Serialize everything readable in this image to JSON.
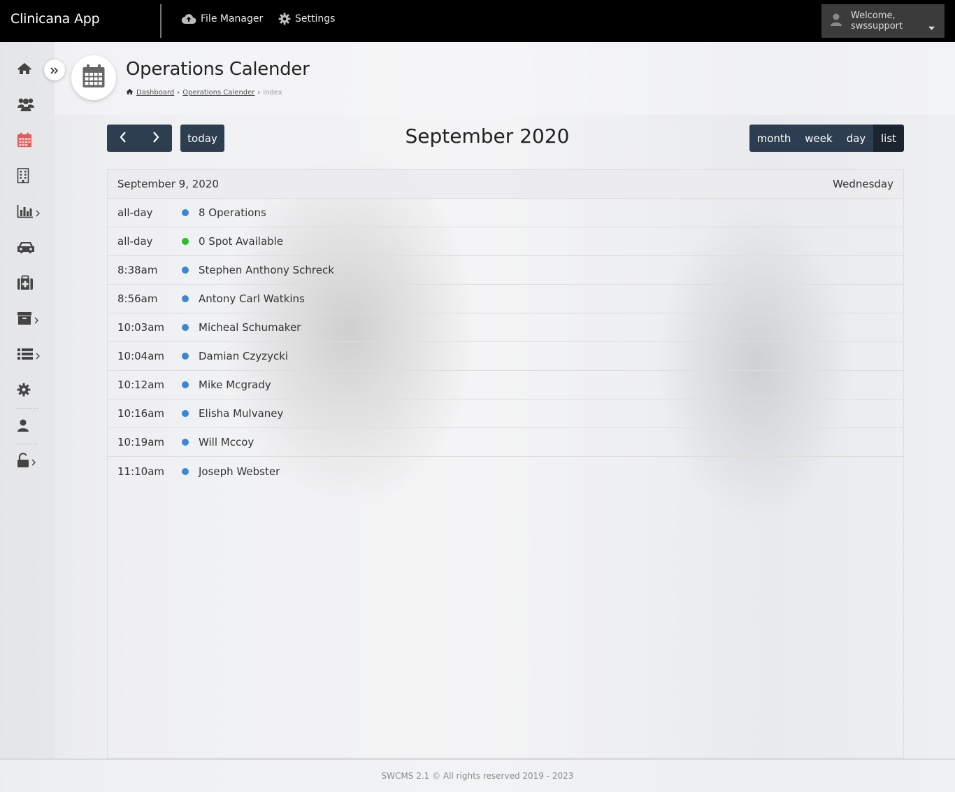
{
  "app": {
    "brand": "Clinicana App"
  },
  "topnav": {
    "file_manager": "File Manager",
    "settings": "Settings",
    "welcome_line1": "Welcome,",
    "welcome_line2": "swssupport"
  },
  "sidebar": {
    "items": [
      {
        "icon": "home-icon"
      },
      {
        "icon": "users-icon"
      },
      {
        "icon": "calendar-icon",
        "active": true,
        "color": "#e05c5c"
      },
      {
        "icon": "building-icon"
      },
      {
        "icon": "bar-chart-icon",
        "has_submenu": true
      },
      {
        "icon": "car-icon"
      },
      {
        "icon": "medkit-icon"
      },
      {
        "icon": "archive-icon",
        "has_submenu": true
      },
      {
        "icon": "list-icon",
        "has_submenu": true
      },
      {
        "icon": "gear-icon"
      },
      {
        "icon": "user-icon"
      },
      {
        "icon": "unlock-icon",
        "has_submenu": true
      }
    ]
  },
  "page": {
    "title": "Operations Calender",
    "breadcrumb": {
      "dashboard": "Dashboard",
      "operations": "Operations Calender",
      "current": "index"
    }
  },
  "calendar": {
    "today_label": "today",
    "title": "September 2020",
    "views": {
      "month": "month",
      "week": "week",
      "day": "day",
      "list": "list"
    },
    "active_view": "list",
    "day_heading_date": "September 9, 2020",
    "day_heading_weekday": "Wednesday",
    "events": [
      {
        "time": "all-day",
        "title": "8 Operations",
        "dot": "#3b87d4"
      },
      {
        "time": "all-day",
        "title": "0 Spot Available",
        "dot": "#2bbb2b"
      },
      {
        "time": "8:38am",
        "title": "Stephen Anthony Schreck",
        "dot": "#3b87d4"
      },
      {
        "time": "8:56am",
        "title": "Antony Carl Watkins",
        "dot": "#3b87d4"
      },
      {
        "time": "10:03am",
        "title": "Micheal Schumaker",
        "dot": "#3b87d4"
      },
      {
        "time": "10:04am",
        "title": "Damian Czyzycki",
        "dot": "#3b87d4"
      },
      {
        "time": "10:12am",
        "title": "Mike Mcgrady",
        "dot": "#3b87d4"
      },
      {
        "time": "10:16am",
        "title": "Elisha Mulvaney",
        "dot": "#3b87d4"
      },
      {
        "time": "10:19am",
        "title": "Will Mccoy",
        "dot": "#3b87d4"
      },
      {
        "time": "11:10am",
        "title": "Joseph Webster",
        "dot": "#3b87d4"
      }
    ]
  },
  "footer": {
    "text": "SWCMS 2.1 © All rights reserved 2019 - 2023"
  },
  "colors": {
    "topbar": "#000000",
    "button": "#2c3e50",
    "button_active": "#1a252f",
    "event_blue": "#3b87d4",
    "event_green": "#2bbb2b"
  }
}
